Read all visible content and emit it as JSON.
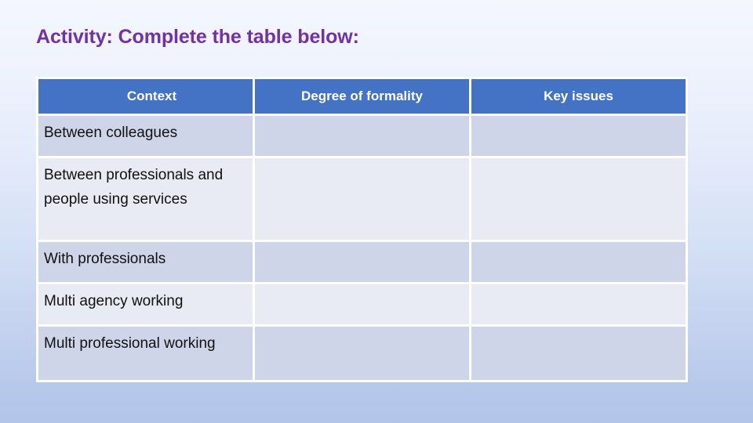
{
  "slide": {
    "title": "Activity: Complete the table below:",
    "title_color": "#7231a7",
    "background_top_color": "#f4f7fe",
    "background_bottom_color": "#b2c5e9"
  },
  "table": {
    "header_background": "#4472c4",
    "header_text_color": "#ffffff",
    "gridline_color": "#ffffff",
    "row_shade_dark": "#cfd5e9",
    "row_shade_light": "#e8ebf4",
    "columns": [
      {
        "label": "Context"
      },
      {
        "label": "Degree of formality"
      },
      {
        "label": "Key issues"
      }
    ],
    "rows": [
      {
        "context": "Between colleagues",
        "degree_of_formality": "",
        "key_issues": ""
      },
      {
        "context": "Between professionals and people using services",
        "degree_of_formality": "",
        "key_issues": ""
      },
      {
        "context": "With professionals",
        "degree_of_formality": "",
        "key_issues": ""
      },
      {
        "context": "Multi agency working",
        "degree_of_formality": "",
        "key_issues": ""
      },
      {
        "context": "Multi professional working",
        "degree_of_formality": "",
        "key_issues": ""
      }
    ]
  }
}
